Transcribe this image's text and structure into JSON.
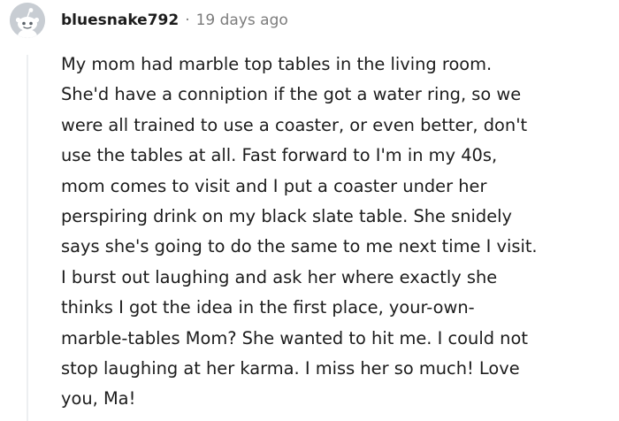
{
  "comment": {
    "username": "bluesnake792",
    "separator": "·",
    "timestamp": "19 days ago",
    "avatar_icon": "snoo-avatar-icon",
    "avatar_color": "#c8cdd3",
    "body_lines": [
      "My mom had marble top tables in the living room.",
      "She'd have a conniption if the got a water ring, so we",
      "were all trained to use a coaster, or even better, don't",
      "use the tables at all. Fast forward to I'm in my 40s,",
      "mom comes to visit and I put a coaster under her",
      "perspiring drink on my black slate table. She snidely",
      "says she's going to do the same to me next time I visit.",
      "I burst out laughing and ask her where exactly she",
      "thinks I got the idea in the first place, your-own-",
      "marble-tables Mom? She wanted to hit me. I could not",
      "stop laughing at her karma. I miss her so much! Love",
      "you, Ma!"
    ]
  }
}
